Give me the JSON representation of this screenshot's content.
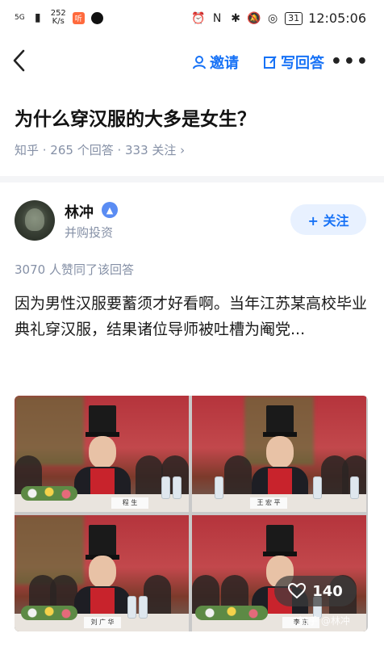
{
  "status_bar": {
    "signal": "5G",
    "speed_value": "252",
    "speed_unit": "K/s",
    "app_badge": "听",
    "battery": "31",
    "time": "12:05:06"
  },
  "toolbar": {
    "invite_label": "邀请",
    "write_answer_label": "写回答",
    "more_label": "•••"
  },
  "question": {
    "title": "为什么穿汉服的大多是女生？",
    "meta": "知乎 · 265 个回答 · 333 关注 ›"
  },
  "answer": {
    "author": "林冲",
    "author_bio": "并购投资",
    "follow_label": "+ 关注",
    "votes_text": "3070 人赞同了该回答",
    "excerpt": "因为男性汉服要蓄须才好看啊。当年江苏某高校毕业典礼穿汉服，结果诸位导师被吐槽为阉党..."
  },
  "image": {
    "nameplates": [
      "程 生",
      "王 宏 平",
      "刘 广 华",
      "李 东"
    ],
    "like_count": "140",
    "watermark": "知乎 @林冲"
  },
  "colors": {
    "accent": "#1772f6",
    "muted": "#8590a6",
    "follow_bg": "#e8f1ff"
  },
  "icons": {
    "back": "back-arrow-icon",
    "invite": "person-icon",
    "write": "edit-icon",
    "like": "heart-icon",
    "verified": "verified-badge-icon"
  }
}
